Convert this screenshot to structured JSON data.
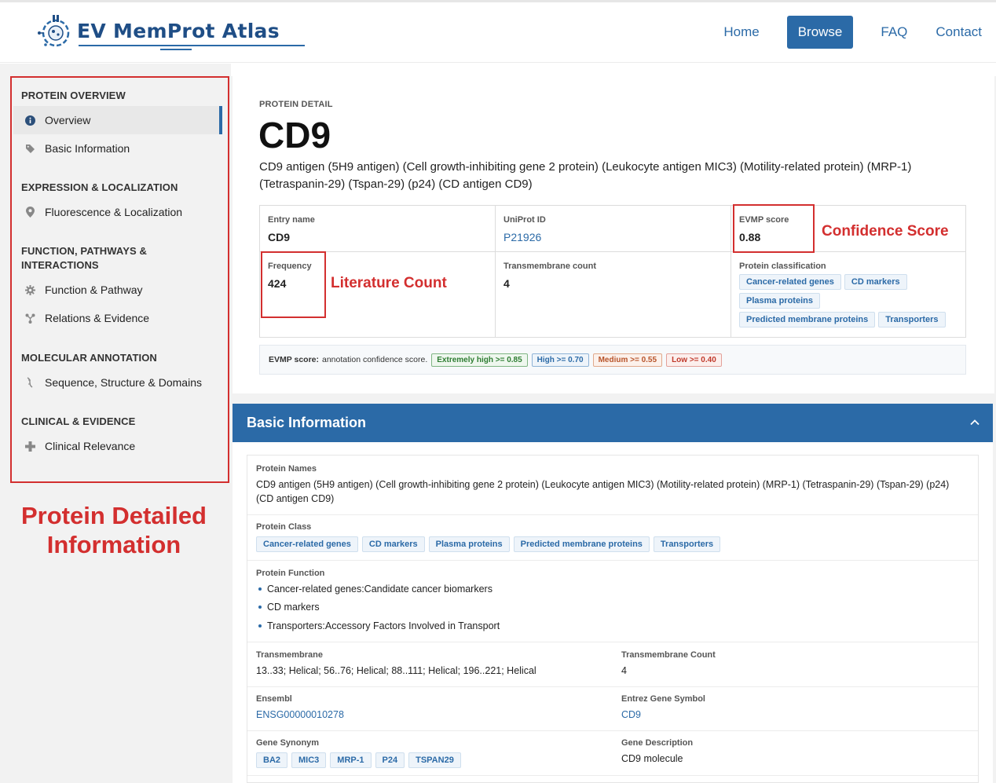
{
  "header": {
    "logo_text": "EV MemProt Atlas",
    "nav": [
      "Home",
      "Browse",
      "FAQ",
      "Contact"
    ],
    "active_nav": "Browse"
  },
  "sidebar": {
    "sections": [
      {
        "title": "PROTEIN OVERVIEW",
        "items": [
          "Overview",
          "Basic Information"
        ]
      },
      {
        "title": "EXPRESSION & LOCALIZATION",
        "items": [
          "Fluorescence & Localization"
        ]
      },
      {
        "title": "FUNCTION, PATHWAYS & INTERACTIONS",
        "items": [
          "Function & Pathway",
          "Relations & Evidence"
        ]
      },
      {
        "title": "MOLECULAR ANNOTATION",
        "items": [
          "Sequence, Structure & Domains"
        ]
      },
      {
        "title": "CLINICAL & EVIDENCE",
        "items": [
          "Clinical Relevance"
        ]
      }
    ],
    "active_item": "Overview"
  },
  "annotations": {
    "left": "Protein Detailed Information",
    "confidence": "Confidence Score",
    "literature": "Literature Count"
  },
  "detail": {
    "label": "PROTEIN DETAIL",
    "title": "CD9",
    "description": "CD9 antigen (5H9 antigen) (Cell growth-inhibiting gene 2 protein) (Leukocyte antigen MIC3) (Motility-related protein) (MRP-1) (Tetraspanin-29) (Tspan-29) (p24) (CD antigen CD9)",
    "entry_name_label": "Entry name",
    "entry_name": "CD9",
    "uniprot_label": "UniProt ID",
    "uniprot": "P21926",
    "evmp_label": "EVMP score",
    "evmp": "0.88",
    "frequency_label": "Frequency",
    "frequency": "424",
    "tm_count_label": "Transmembrane count",
    "tm_count": "4",
    "classification_label": "Protein classification",
    "classification": [
      "Cancer-related genes",
      "CD markers",
      "Plasma proteins",
      "Predicted membrane proteins",
      "Transporters"
    ]
  },
  "legend": {
    "label": "EVMP score:",
    "text": "annotation confidence score.",
    "levels": [
      "Extremely high >= 0.85",
      "High >= 0.70",
      "Medium >= 0.55",
      "Low >= 0.40"
    ],
    "colors": [
      "#2e7d32",
      "#2b6aa7",
      "#b8542a",
      "#c0392b"
    ]
  },
  "basic": {
    "title": "Basic Information",
    "names_label": "Protein Names",
    "names_line1": "CD9 antigen (5H9 antigen) (Cell growth-inhibiting gene 2 protein) (Leukocyte antigen MIC3) (Motility-related protein) (MRP-1) (Tetraspanin-29) (Tspan-29) (p24)",
    "names_line2": "(CD antigen CD9)",
    "class_label": "Protein Class",
    "classes": [
      "Cancer-related genes",
      "CD markers",
      "Plasma proteins",
      "Predicted membrane proteins",
      "Transporters"
    ],
    "function_label": "Protein Function",
    "functions": [
      "Cancer-related genes:Candidate cancer biomarkers",
      "CD markers",
      "Transporters:Accessory Factors Involved in Transport"
    ],
    "tm_label": "Transmembrane",
    "tm": "13..33; Helical; 56..76; Helical; 88..111; Helical; 196..221; Helical",
    "tm_count_label": "Transmembrane Count",
    "tm_count": "4",
    "ensembl_label": "Ensembl",
    "ensembl": "ENSG00000010278",
    "entrez_label": "Entrez Gene Symbol",
    "entrez": "CD9",
    "synonym_label": "Gene Synonym",
    "synonyms": [
      "BA2",
      "MIC3",
      "MRP-1",
      "P24",
      "TSPAN29"
    ],
    "gene_desc_label": "Gene Description",
    "gene_desc": "CD9 molecule"
  }
}
